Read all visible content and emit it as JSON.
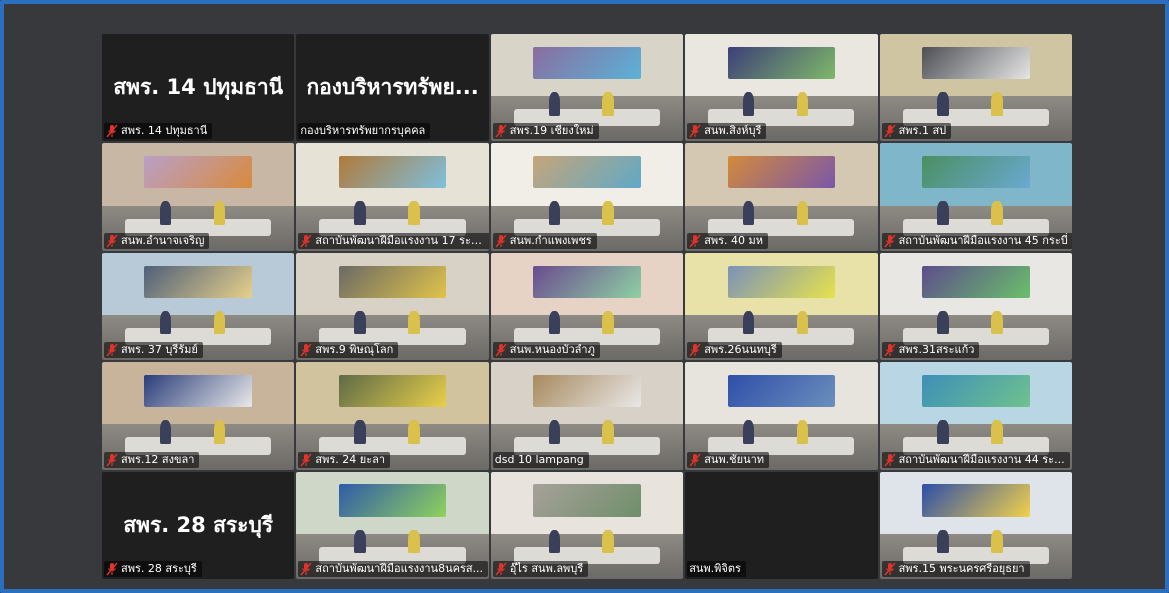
{
  "app": "video-conference-gallery",
  "colors": {
    "frame": "#2d6fbf",
    "active_border": "#3fd29b",
    "muted_mic": "#e0332b"
  },
  "tiles": [
    {
      "label": "สพร. 14 ปทุมธานี",
      "card": "สพร. 14 ปทุมธานี",
      "muted": true,
      "video": false
    },
    {
      "label": "กองบริหารทรัพยากรบุคคล",
      "card": "กองบริหารทรัพย...",
      "muted": false,
      "video": false
    },
    {
      "label": "สพร.19 เชียงใหม่",
      "muted": true,
      "video": true
    },
    {
      "label": "สนพ.สิงห์บุรี",
      "muted": true,
      "video": true
    },
    {
      "label": "สพร.1 สป",
      "muted": true,
      "video": true
    },
    {
      "label": "สนพ.อำนาจเจริญ",
      "muted": true,
      "video": true
    },
    {
      "label": "สถาบันพัฒนาฝีมือแรงงาน 17 ระย...",
      "muted": true,
      "video": true
    },
    {
      "label": "สนพ.กำแพงเพชร",
      "muted": true,
      "video": true
    },
    {
      "label": "สพร. 40 มห",
      "muted": true,
      "video": true
    },
    {
      "label": "สถาบันพัฒนาฝีมือแรงงาน 45 กระบี่",
      "muted": true,
      "video": true
    },
    {
      "label": "สพร. 37 บุรีรัมย์",
      "muted": true,
      "video": true
    },
    {
      "label": "สพร.9 พิษณุโลก",
      "muted": true,
      "video": true
    },
    {
      "label": "สนพ.หนองบัวลำภู",
      "muted": true,
      "video": true
    },
    {
      "label": "สพร.26นนทบุรี",
      "muted": true,
      "video": true
    },
    {
      "label": "สพร.31สระแก้ว",
      "muted": true,
      "video": true
    },
    {
      "label": "สพร.12 สงขลา",
      "muted": true,
      "video": true
    },
    {
      "label": "สพร. 24 ยะลา",
      "muted": true,
      "video": true
    },
    {
      "label": "dsd 10 lampang",
      "muted": false,
      "video": true,
      "active": true
    },
    {
      "label": "สนพ.ชัยนาท",
      "muted": true,
      "video": true
    },
    {
      "label": "สถาบันพัฒนาฝีมือแรงงาน 44 ระ...",
      "muted": true,
      "video": true
    },
    {
      "label": "สพร. 28 สระบุรี",
      "card": "สพร. 28 สระบุรี",
      "muted": true,
      "video": false
    },
    {
      "label": "สถาบันพัฒนาฝีมือแรงงาน8นครส...",
      "muted": true,
      "video": true
    },
    {
      "label": "อุ๊ไร สนพ.ลพบุรี",
      "muted": true,
      "video": true
    },
    {
      "label": "สนพ.พิจิตร",
      "muted": false,
      "video": false
    },
    {
      "label": "สพร.15 พระนครศรีอยุธยา",
      "muted": true,
      "video": true
    }
  ]
}
